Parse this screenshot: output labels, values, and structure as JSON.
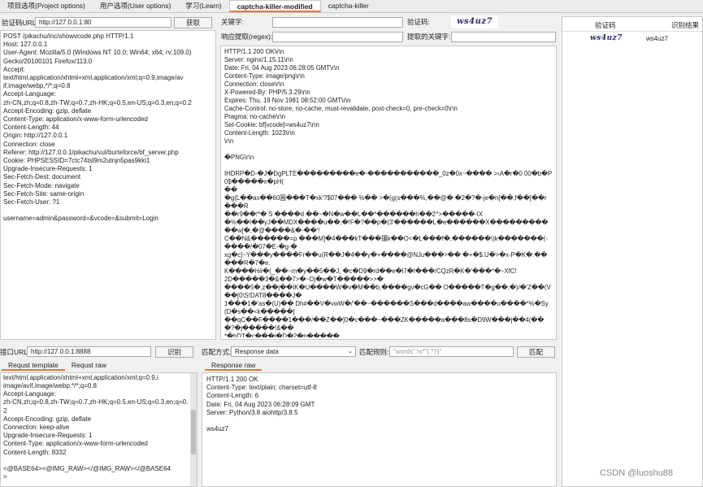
{
  "tabs": [
    {
      "label": "项目选项(Project options)"
    },
    {
      "label": "用户选项(User options)"
    },
    {
      "label": "学习(Learn)"
    },
    {
      "label": "captcha-killer-modified"
    },
    {
      "label": "captcha-killer"
    }
  ],
  "captcha_url": {
    "label": "验证码URL:",
    "value": "http://127.0.0.1:80",
    "button": "获取"
  },
  "request_raw": "POST /pikachu/inc/showvcode.php HTTP/1.1\nHost: 127.0.0.1\nUser-Agent: Mozilla/5.0 (Windows NT 10.0; Win64; x64; rv:109.0)\nGecko/20100101 Firefox/113.0\nAccept:\ntext/html,application/xhtml+xml,application/xml;q=0.9,image/av\nif,image/webp,*/*;q=0.8\nAccept-Language:\nzh-CN,zh;q=0.8,zh-TW;q=0.7,zh-HK;q=0.5,en-US;q=0.3,en;q=0.2\nAccept-Encoding: gzip, deflate\nContent-Type: application/x-www-form-urlencoded\nContent-Length: 44\nOrigin: http://127.0.0.1\nConnection: close\nReferer: http://127.0.0.1/pikachu/vul/burteforce/bf_server.php\nCookie: PHPSESSID=7ctc74tsl9m2utnjn5pas9kki1\nUpgrade-Insecure-Requests: 1\nSec-Fetch-Dest: document\nSec-Fetch-Mode: navigate\nSec-Fetch-Site: same-origin\nSec-Fetch-User: ?1\n\nusername=admin&password=&vcode=&submit=Login",
  "keyword": {
    "label": "关键字:",
    "value": ""
  },
  "captcha_label": "验证码:",
  "captcha_text": "ws4uz7",
  "regex": {
    "label": "响应提取(regex):",
    "value": "",
    "extracted_label": "提取的关键字:"
  },
  "response_raw": "HTTP/1.1 200 OK\\r\\n\nServer: nginx/1.15.11\\r\\n\nDate: Fri, 04 Aug 2023 06:28:05 GMT\\r\\n\nContent-Type: image/png\\r\\n\nConnection: close\\r\\n\nX-Powered-By: PHP/5.3.29\\r\\n\nExpires: Thu, 19 Nov 1981 08:52:00 GMT\\r\\n\nCache-Control: no-store, no-cache, must-revalidate, post-check=0, pre-check=0\\r\\n\nPragma: no-cache\\r\\n\nSet-Cookie: bf[vcode]=ws4uz7\\r\\n\nContent-Length: 1023\\r\\n\n\\r\\n\n\n�PNG\\r\\n\n\nIHDRP�D-�J�DgPLTE���������e�-�����������_0z�0x~���� >‹A�r�0 00�b�P0$�����x�pH(\n��\n�g(L��ax��60圓���T�xk'?$07��� %�� >�(g(s���%,��@� �2�?�-je�n[��,f��[��r���R\n��r9��!*� S ����d ��~�N�w��L��*������h��2^>�����-IX\n�%��I��yJ��MDX����u��;�!F�?��p�(3'������L�e������X�����������w[�,�@����&�-��'!\nC��N&������=p ���M]�4���kT���攘k��O<�L���f�,������\\)k�������(-����/�07�E-�g-�\nxg�c]~Y���y����Fr��u(R��J�4��y�+����@NJu���>�� �+�$.U�>�x-P�K�.�����R�7�e.\nK����H#�(_��~m�y��5��J, �c�D9�rd��e�l7�I���/CQzR�K�'���*�~XfC!\n2D�����3�&��7>�~Dj�w�T�����>>�\n����5�,z��j��IK�U����W�v�M��b,����gv�cG�� O�����T�g��,�)/�'Z��(V��[0\\S!DAT8����J�\n1���1�'as�(U)�� Dh#��V�vwW�/'��~������S���d����aw����u����*%�Sy(D�s��<k�����]\n��qC��F����1���/��Z��]0�c���~���ZK�����a���8s�D9W���j��4(���?�j�����!&��\n*�bDT�c���i�D�2�p�����\nt����[�-DWf�I[請5a)☆;]��!o�\\C4������b�����EM����������H.�♠>�j���_BXk�����W�\n�6\\p���,r�������_�v���XYvAf)��������Ua��I|t��O:L�qI�;�W3��\\�fC���E��������8��\nIEND�B`�",
  "api_url": {
    "label": "接口URL:",
    "value": "http://127.0.0.1:8888",
    "button": "识别"
  },
  "req_tabs": [
    {
      "label": "Requst template"
    },
    {
      "label": "Requst raw"
    }
  ],
  "req_template": "image/avif,image/webp,*/*;q=0.8\nAccept-Language:\nzh-CN,zh;q=0.8,zh-TW;q=0.7,zh-HK;q=0.5,en-US;q=0.3,en;q=0.2\nAccept-Encoding: gzip, deflate\nConnection: keep-alive\nUpgrade-Insecure-Requests: 1\nContent-Type: application/x-www-form-urlencoded\nContent-Length: 8332\n\n<@BASE64><@IMG_RAW></@IMG_RAW></@BASE64\n>",
  "req_template_top": "text/html,application/xhtml+xml,application/xml;q=0.9,i",
  "match": {
    "mode_label": "匹配方式:",
    "mode_value": "Response data",
    "rule_label": "匹配规则:",
    "rule_placeholder": "\"words\":\\s*\"(.*?)\"",
    "button": "匹配"
  },
  "resp_tabs": [
    {
      "label": "Response raw"
    }
  ],
  "api_response": "HTTP/1.1 200 OK\nContent-Type: text/plain; charset=utf-8\nContent-Length: 6\nDate: Fri, 04 Aug 2023 06:28:09 GMT\nServer: Python/3.8 aiohttp/3.8.5\n\nws4uz7",
  "results": {
    "col_captcha": "验证码",
    "col_result": "识别结果",
    "row_captcha": "ws4uz7",
    "row_result": "ws4uz7"
  },
  "watermark": "CSDN @luoshu88"
}
